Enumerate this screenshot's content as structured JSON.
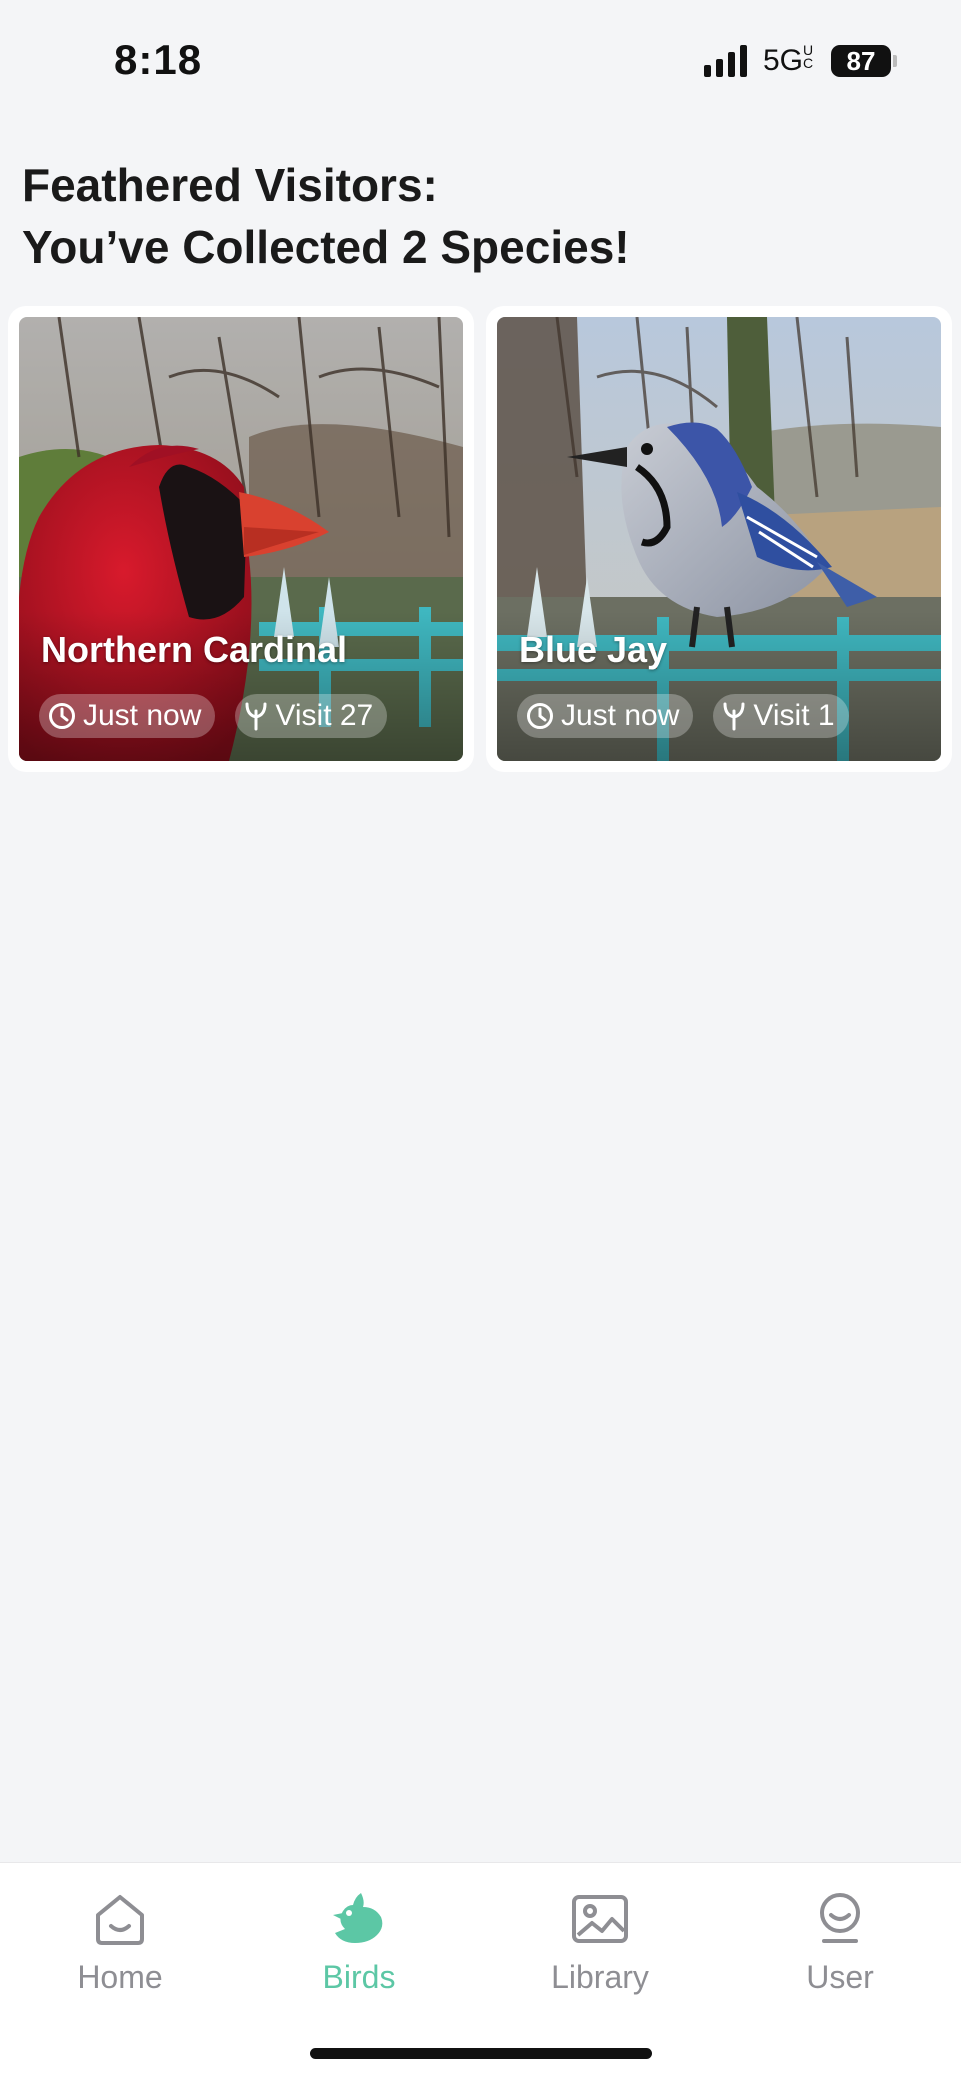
{
  "status_bar": {
    "time": "8:18",
    "network": "5G",
    "network_suffix": "UC",
    "battery": "87"
  },
  "page": {
    "title_line1": "Feathered Visitors:",
    "title_line2": "You’ve Collected 2 Species!"
  },
  "birds": [
    {
      "name": "Northern Cardinal",
      "time_label": "Just now",
      "visit_label": "Visit 27",
      "photo_description": "cardinal-photo"
    },
    {
      "name": "Blue Jay",
      "time_label": "Just now",
      "visit_label": "Visit 1",
      "photo_description": "blue-jay-photo"
    }
  ],
  "tabs": [
    {
      "label": "Home",
      "icon": "home-icon",
      "active": false
    },
    {
      "label": "Birds",
      "icon": "bird-icon",
      "active": true
    },
    {
      "label": "Library",
      "icon": "image-icon",
      "active": false
    },
    {
      "label": "User",
      "icon": "user-icon",
      "active": false
    }
  ],
  "colors": {
    "accent": "#5cc7a5",
    "inactive": "#8e8e93",
    "background": "#f4f5f7"
  }
}
